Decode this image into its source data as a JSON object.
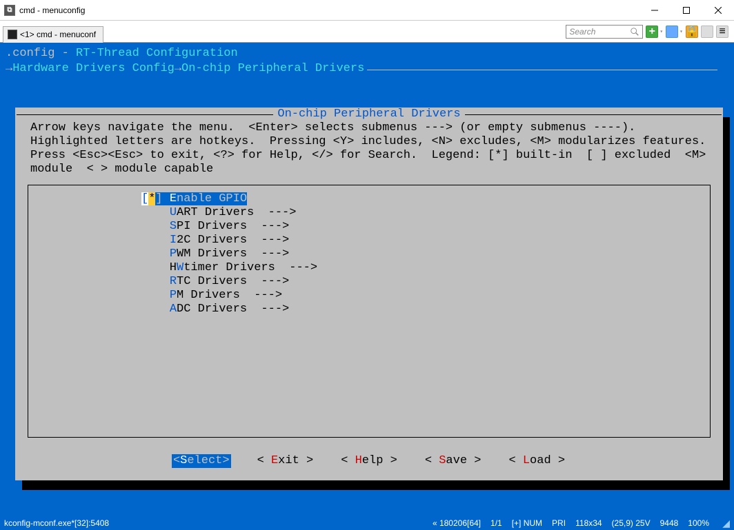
{
  "window": {
    "title": "cmd - menuconfig"
  },
  "tab": {
    "label": "<1> cmd - menuconf"
  },
  "search": {
    "placeholder": "Search"
  },
  "config": {
    "header_prefix": ".config - ",
    "header_title": "RT-Thread Configuration",
    "breadcrumb": [
      "Hardware Drivers Config",
      "On-chip Peripheral Drivers"
    ],
    "panel_title": "On-chip Peripheral Drivers",
    "help_text": "Arrow keys navigate the menu.  <Enter> selects submenus ---> (or empty submenus ----).  Highlighted letters are hotkeys.  Pressing <Y> includes, <N> excludes, <M> modularizes features.  Press <Esc><Esc> to exit, <?> for Help, </> for Search.  Legend: [*] built-in  [ ] excluded  <M> module  < > module capable",
    "menu": [
      {
        "prefix": "[*]",
        "hotkey": "E",
        "rest": "nable GPIO",
        "submenu": false,
        "selected": true
      },
      {
        "prefix": "   ",
        "hotkey": "U",
        "rest": "ART Drivers  --->",
        "submenu": true,
        "selected": false
      },
      {
        "prefix": "   ",
        "hotkey": "S",
        "rest": "PI Drivers  --->",
        "submenu": true,
        "selected": false
      },
      {
        "prefix": "   ",
        "hotkey": "I",
        "rest": "2C Drivers  --->",
        "submenu": true,
        "selected": false
      },
      {
        "prefix": "   ",
        "hotkey": "P",
        "rest": "WM Drivers  --->",
        "submenu": true,
        "selected": false
      },
      {
        "prefix": "   ",
        "hotkey_pre": "H",
        "hotkey": "W",
        "rest": "timer Drivers  --->",
        "submenu": true,
        "selected": false
      },
      {
        "prefix": "   ",
        "hotkey": "R",
        "rest": "TC Drivers  --->",
        "submenu": true,
        "selected": false
      },
      {
        "prefix": "   ",
        "hotkey": "P",
        "rest": "M Drivers  --->",
        "submenu": true,
        "selected": false
      },
      {
        "prefix": "   ",
        "hotkey": "A",
        "rest": "DC Drivers  --->",
        "submenu": true,
        "selected": false
      }
    ],
    "buttons": [
      {
        "pre": "<",
        "hot": "S",
        "post": "elect>",
        "selected": true
      },
      {
        "pre": "< ",
        "hot": "E",
        "post": "xit >",
        "selected": false
      },
      {
        "pre": "< ",
        "hot": "H",
        "post": "elp >",
        "selected": false
      },
      {
        "pre": "< ",
        "hot": "S",
        "post": "ave >",
        "selected": false
      },
      {
        "pre": "< ",
        "hot": "L",
        "post": "oad >",
        "selected": false
      }
    ]
  },
  "status": {
    "process": "kconfig-mconf.exe*[32]:5408",
    "right": [
      "« 180206[64]",
      "1/1",
      "[+] NUM",
      "PRI",
      "118x34",
      "(25,9) 25V",
      "9448",
      "100%"
    ]
  }
}
